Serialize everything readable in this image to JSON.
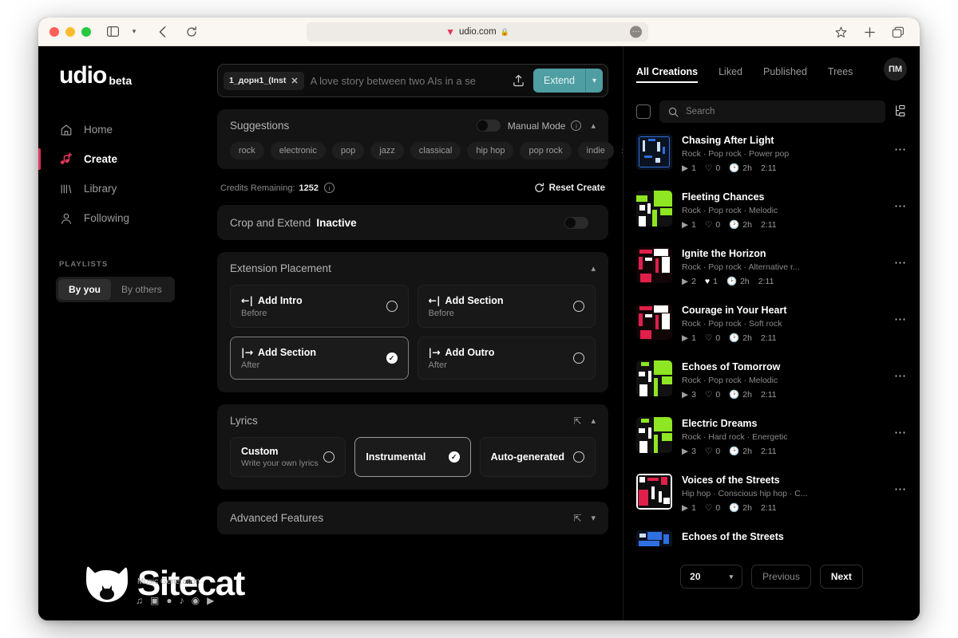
{
  "browser": {
    "url": "udio.com",
    "favicon_icon": "udio-logo-icon",
    "lock_icon": "lock-icon",
    "back_icon": "chevron-left-icon",
    "reload_icon": "reload-icon",
    "sidebar_icon": "sidebar-toggle-icon",
    "sidebar_caret_icon": "chevron-down-icon",
    "more_icon": "ellipsis-icon",
    "bookmark_icon": "star-icon",
    "newtab_icon": "plus-icon",
    "tabs_icon": "tab-overview-icon"
  },
  "sidebar": {
    "brand": "udio",
    "brand_suffix": "beta",
    "collapse_icon": "collapse-sidebar-icon",
    "items": [
      {
        "label": "Home",
        "icon": "home-icon",
        "active": false
      },
      {
        "label": "Create",
        "icon": "music-note-plus-icon",
        "active": true
      },
      {
        "label": "Library",
        "icon": "library-bars-icon",
        "active": false
      },
      {
        "label": "Following",
        "icon": "person-icon",
        "active": false
      }
    ],
    "playlists_heading": "PLAYLISTS",
    "playlist_tabs": [
      {
        "label": "By you",
        "active": true
      },
      {
        "label": "By others",
        "active": false
      }
    ],
    "active_accent_color": "#e0355a"
  },
  "prompt": {
    "chip_label": "1_дорн1_(Inst",
    "chip_close_icon": "close-icon",
    "placeholder": "A love story between two AIs in a se",
    "value": "",
    "upload_icon": "upload-icon",
    "extend_label": "Extend",
    "extend_caret_icon": "chevron-down-icon",
    "extend_color": "#4f9ea3"
  },
  "suggestions": {
    "title": "Suggestions",
    "manual_mode_label": "Manual Mode",
    "manual_mode_on": false,
    "info_icon": "info-icon",
    "collapse_icon": "chevron-up-icon",
    "tags": [
      "rock",
      "electronic",
      "pop",
      "jazz",
      "classical",
      "hip hop",
      "pop rock",
      "indie"
    ],
    "next_icon": "chevron-right-icon"
  },
  "credits": {
    "label": "Credits Remaining:",
    "value": "1252",
    "info_icon": "info-icon",
    "reset_label": "Reset Create",
    "reset_icon": "refresh-icon"
  },
  "crop_extend": {
    "label": "Crop and Extend",
    "state": "Inactive",
    "toggle_on": false
  },
  "extension_placement": {
    "title": "Extension Placement",
    "collapse_icon": "chevron-up-icon",
    "options": [
      {
        "arrow": "←|",
        "title": "Add Intro",
        "subtitle": "Before",
        "selected": false
      },
      {
        "arrow": "←|",
        "title": "Add Section",
        "subtitle": "Before",
        "selected": false
      },
      {
        "arrow": "|→",
        "title": "Add Section",
        "subtitle": "After",
        "selected": true
      },
      {
        "arrow": "|→",
        "title": "Add Outro",
        "subtitle": "After",
        "selected": false
      }
    ]
  },
  "lyrics": {
    "title": "Lyrics",
    "expand_icon": "expand-icon",
    "collapse_icon": "chevron-up-icon",
    "options": [
      {
        "title": "Custom",
        "subtitle": "Write your own lyrics",
        "selected": false
      },
      {
        "title": "Instrumental",
        "subtitle": "",
        "selected": true
      },
      {
        "title": "Auto-generated",
        "subtitle": "",
        "selected": false
      }
    ]
  },
  "advanced_features": {
    "title": "Advanced Features",
    "expand_icon": "expand-icon",
    "collapse_icon": "chevron-down-icon"
  },
  "right_panel": {
    "tabs": [
      {
        "label": "All Creations",
        "active": true
      },
      {
        "label": "Liked",
        "active": false
      },
      {
        "label": "Published",
        "active": false
      },
      {
        "label": "Trees",
        "active": false
      }
    ],
    "avatar_initials": "ПМ",
    "select_all_checked": false,
    "search_placeholder": "Search",
    "search_icon": "search-icon",
    "tree_view_icon": "tree-view-icon",
    "tracks": [
      {
        "name": "Chasing After Light",
        "genres": "Rock  ·  Pop rock  ·  Power pop",
        "plays": "1",
        "likes": "0",
        "age": "2h",
        "duration": "2:11",
        "liked": false,
        "art_color": "#2f6fe0",
        "art_accent": "#cfe0ff",
        "menu_icon": "more-options-icon"
      },
      {
        "name": "Fleeting Chances",
        "genres": "Rock  ·  Pop rock  ·  Melodic",
        "plays": "1",
        "likes": "0",
        "age": "2h",
        "duration": "2:11",
        "liked": false,
        "art_color": "#8fe622",
        "art_accent": "#ffffff",
        "menu_icon": "more-options-icon"
      },
      {
        "name": "Ignite the Horizon",
        "genres": "Rock  ·  Pop rock  ·  Alternative r...",
        "plays": "2",
        "likes": "1",
        "age": "2h",
        "duration": "2:11",
        "liked": true,
        "art_color": "#e01f4a",
        "art_accent": "#ffffff",
        "menu_icon": "more-options-icon"
      },
      {
        "name": "Courage in Your Heart",
        "genres": "Rock  ·  Pop rock  ·  Soft rock",
        "plays": "1",
        "likes": "0",
        "age": "2h",
        "duration": "2:11",
        "liked": false,
        "art_color": "#e01f4a",
        "art_accent": "#ffffff",
        "menu_icon": "more-options-icon"
      },
      {
        "name": "Echoes of Tomorrow",
        "genres": "Rock  ·  Pop rock  ·  Melodic",
        "plays": "3",
        "likes": "0",
        "age": "2h",
        "duration": "2:11",
        "liked": false,
        "art_color": "#8fe622",
        "art_accent": "#ffffff",
        "menu_icon": "more-options-icon"
      },
      {
        "name": "Electric Dreams",
        "genres": "Rock  ·  Hard rock  ·  Energetic",
        "plays": "3",
        "likes": "0",
        "age": "2h",
        "duration": "2:11",
        "liked": false,
        "art_color": "#8fe622",
        "art_accent": "#ffffff",
        "menu_icon": "more-options-icon"
      },
      {
        "name": "Voices of the Streets",
        "genres": "Hip hop  ·  Conscious hip hop  ·  C...",
        "plays": "1",
        "likes": "0",
        "age": "2h",
        "duration": "2:11",
        "liked": false,
        "art_color": "#e01f4a",
        "art_accent": "#ffffff",
        "menu_icon": "more-options-icon"
      },
      {
        "name": "Echoes of the Streets",
        "genres": "",
        "plays": "",
        "likes": "",
        "age": "",
        "duration": "",
        "liked": false,
        "art_color": "#2f6fe0",
        "art_accent": "#cfe0ff",
        "menu_icon": "more-options-icon"
      }
    ],
    "pagination": {
      "page_size": "20",
      "page_size_caret_icon": "chevron-down-icon",
      "previous_label": "Previous",
      "next_label": "Next"
    }
  },
  "watermark": {
    "text": "Sitecat",
    "subtitle": "Music Generation",
    "logo_icon": "cat-logo-icon",
    "socials": [
      "tiktok-icon",
      "instagram-icon",
      "discord-icon",
      "tiktok-icon",
      "reddit-icon",
      "youtube-icon"
    ]
  }
}
